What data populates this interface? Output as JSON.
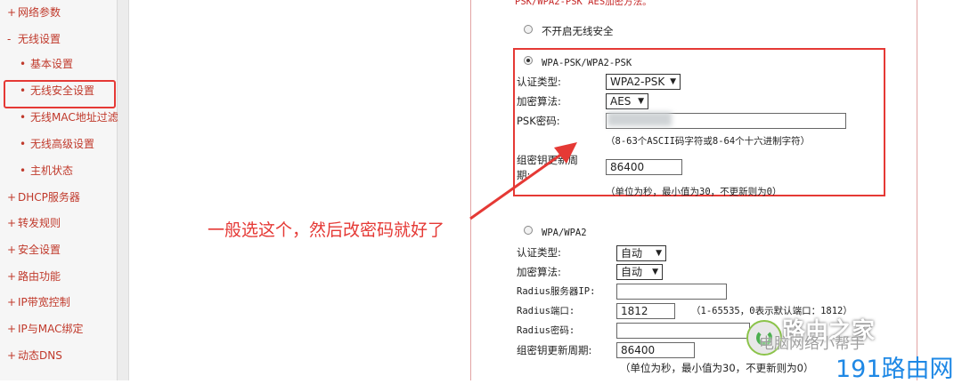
{
  "sidebar": {
    "items": [
      {
        "mark": "+",
        "label": "网络参数",
        "level": "top"
      },
      {
        "mark": "-",
        "label": "无线设置",
        "level": "top"
      },
      {
        "mark": "•",
        "label": "基本设置",
        "level": "sub"
      },
      {
        "mark": "•",
        "label": "无线安全设置",
        "level": "sub",
        "selected": true
      },
      {
        "mark": "•",
        "label": "无线MAC地址过滤",
        "level": "sub"
      },
      {
        "mark": "•",
        "label": "无线高级设置",
        "level": "sub"
      },
      {
        "mark": "•",
        "label": "主机状态",
        "level": "sub"
      },
      {
        "mark": "+",
        "label": "DHCP服务器",
        "level": "top"
      },
      {
        "mark": "+",
        "label": "转发规则",
        "level": "top"
      },
      {
        "mark": "+",
        "label": "安全设置",
        "level": "top"
      },
      {
        "mark": "+",
        "label": "路由功能",
        "level": "top"
      },
      {
        "mark": "+",
        "label": "IP带宽控制",
        "level": "top"
      },
      {
        "mark": "+",
        "label": "IP与MAC绑定",
        "level": "top"
      },
      {
        "mark": "+",
        "label": "动态DNS",
        "level": "top"
      }
    ]
  },
  "form": {
    "intro": "PSK/WPA2-PSK AES加密方法。",
    "no_security": "不开启无线安全",
    "wpa_psk": {
      "title": "WPA-PSK/WPA2-PSK",
      "auth_label": "认证类型:",
      "auth_value": "WPA2-PSK",
      "enc_label": "加密算法:",
      "enc_value": "AES",
      "psk_label": "PSK密码:",
      "psk_hint": "（8-63个ASCII码字符或8-64个十六进制字符）",
      "renew_label_1": "组密钥更新周",
      "renew_label_2": "期:",
      "renew_value": "86400",
      "renew_hint": "（单位为秒，最小值为30，不更新则为0）"
    },
    "wpa": {
      "title": "WPA/WPA2",
      "auth_label": "认证类型:",
      "auth_value": "自动",
      "enc_label": "加密算法:",
      "enc_value": "自动",
      "radius_ip_label": "Radius服务器IP:",
      "radius_port_label": "Radius端口:",
      "radius_port_value": "1812",
      "radius_port_hint": "（1-65535，0表示默认端口：1812）",
      "radius_pwd_label": "Radius密码:",
      "renew_label": "组密钥更新周期:",
      "renew_value": "86400",
      "renew_hint": "（单位为秒，最小值为30，不更新则为0）"
    }
  },
  "annotation": "一般选这个，然后改密码就好了",
  "watermark": {
    "line1": "路由之家",
    "line2": "电脑网络小帮手",
    "line3": "191路由网"
  },
  "colors": {
    "accent_red": "#e53935",
    "nav_red": "#c0392b",
    "brand_blue": "#1e88e5"
  }
}
